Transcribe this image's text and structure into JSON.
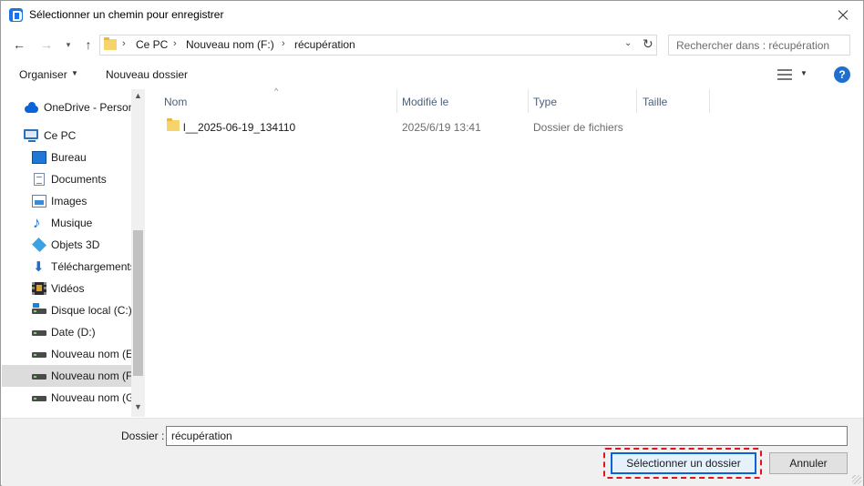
{
  "window": {
    "title": "Sélectionner un chemin pour enregistrer"
  },
  "address": {
    "crumbs": [
      "Ce PC",
      "Nouveau nom (F:)",
      "récupération"
    ],
    "search_placeholder": "Rechercher dans : récupération"
  },
  "toolbar": {
    "organize_label": "Organiser",
    "new_folder_label": "Nouveau dossier"
  },
  "sidebar": {
    "items": [
      {
        "label": "OneDrive - Person",
        "icon": "onedrive-icon"
      },
      {
        "label": "Ce PC",
        "icon": "computer-icon"
      },
      {
        "label": "Bureau",
        "icon": "desktop-icon"
      },
      {
        "label": "Documents",
        "icon": "documents-icon"
      },
      {
        "label": "Images",
        "icon": "pictures-icon"
      },
      {
        "label": "Musique",
        "icon": "music-icon"
      },
      {
        "label": "Objets 3D",
        "icon": "3d-objects-icon"
      },
      {
        "label": "Téléchargements",
        "icon": "downloads-icon"
      },
      {
        "label": "Vidéos",
        "icon": "videos-icon"
      },
      {
        "label": "Disque local (C:)",
        "icon": "system-drive-icon"
      },
      {
        "label": "Date (D:)",
        "icon": "drive-icon"
      },
      {
        "label": "Nouveau nom (E",
        "icon": "drive-icon"
      },
      {
        "label": "Nouveau nom (F",
        "icon": "drive-icon",
        "selected": true
      },
      {
        "label": "Nouveau nom (G",
        "icon": "drive-icon"
      }
    ]
  },
  "file_list": {
    "columns": [
      "Nom",
      "Modifié le",
      "Type",
      "Taille"
    ],
    "rows": [
      {
        "name": "l__2025-06-19_134110",
        "modified": "2025/6/19 13:41",
        "type": "Dossier de fichiers",
        "size": ""
      }
    ]
  },
  "footer": {
    "folder_label": "Dossier :",
    "folder_value": "récupération",
    "select_button": "Sélectionner un dossier",
    "cancel_button": "Annuler"
  },
  "colors": {
    "accent": "#0a64d8",
    "highlight": "#e0141e",
    "selected_row": "#dcdcdc"
  }
}
